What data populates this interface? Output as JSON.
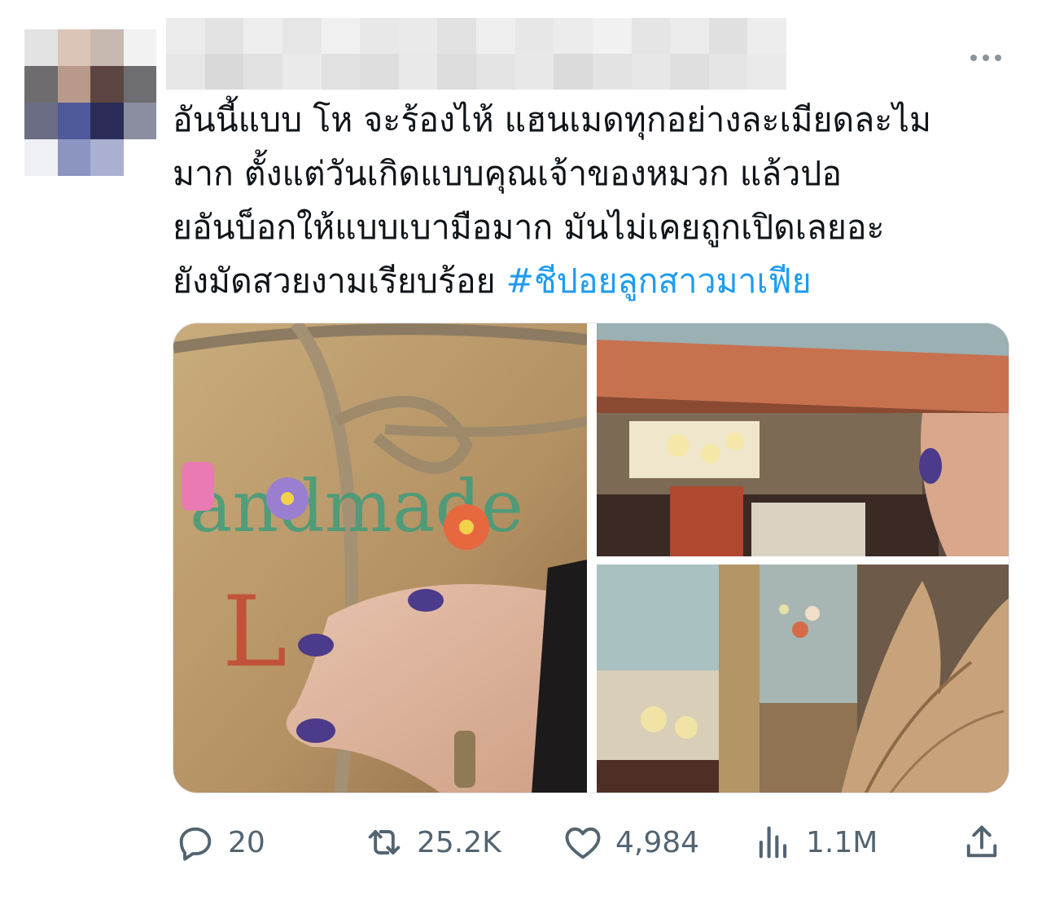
{
  "tweet": {
    "text_main": "อันนี้แบบ โห จะร้องไห้ แฮนเมดทุกอย่างละเมียดละไม\nมาก ตั้งแต่วันเกิดแบบคุณเจ้าของหมวก แล้วปอ\nยอันบ็อกให้แบบเบามือมาก มันไม่เคยถูกเปิดเลยอะ\nยังมัดสวยงามเรียบร้อย ",
    "hashtag": "#ชีปอยลูกสาวมาเฟีย"
  },
  "actions": {
    "replies": "20",
    "retweets": "25.2K",
    "likes": "4,984",
    "views": "1.1M"
  },
  "icons": {
    "more": "more-dots-icon",
    "reply": "reply-icon",
    "retweet": "retweet-icon",
    "like": "heart-icon",
    "views": "views-icon",
    "share": "share-icon"
  },
  "colors": {
    "text": "#0f1419",
    "hashtag": "#1d9bf0",
    "muted": "#536471"
  }
}
